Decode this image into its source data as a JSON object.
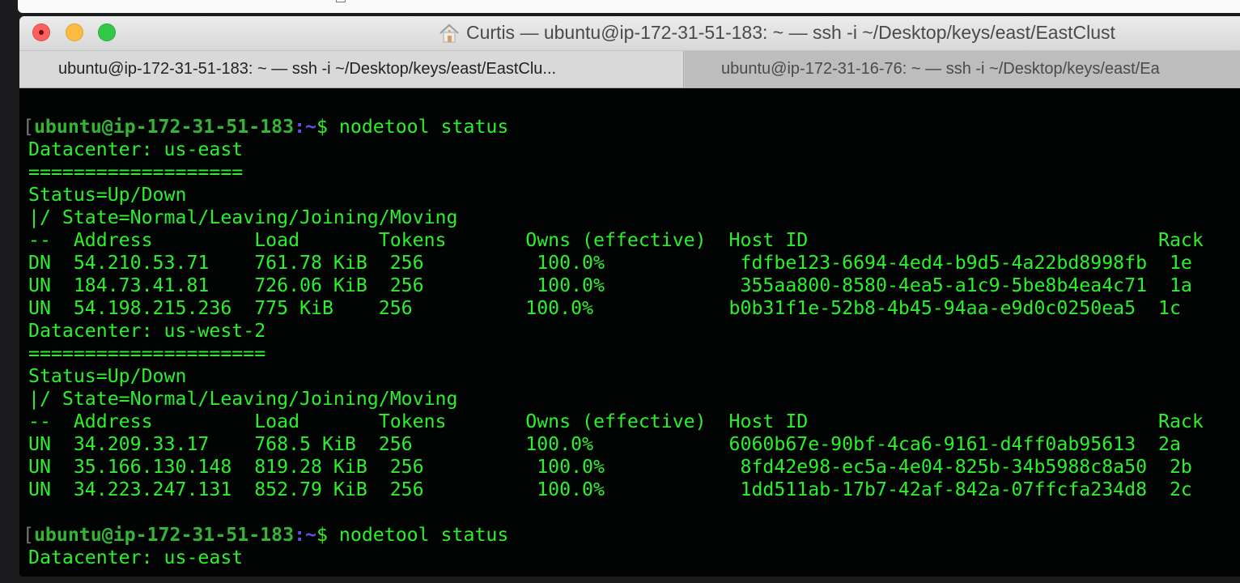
{
  "window": {
    "title": "Curtis — ubuntu@ip-172-31-51-183: ~ — ssh -i ~/Desktop/keys/east/EastClust",
    "tabs": [
      {
        "label": "ubuntu@ip-172-31-51-183: ~ — ssh -i ~/Desktop/keys/east/EastClu...",
        "active": true
      },
      {
        "label": "ubuntu@ip-172-31-16-76: ~ — ssh -i ~/Desktop/keys/east/Ea",
        "active": false
      }
    ]
  },
  "terminal": {
    "prompt": {
      "bracket": "[",
      "user_host": "ubuntu@ip-172-31-51-183",
      "colon": ":",
      "path": "~",
      "dollar": "$ ",
      "command": "nodetool status"
    },
    "block1": [
      "Datacenter: us-east",
      "===================",
      "Status=Up/Down",
      "|/ State=Normal/Leaving/Joining/Moving",
      "--  Address         Load       Tokens       Owns (effective)  Host ID                               Rack",
      "DN  54.210.53.71    761.78 KiB  256          100.0%            fdfbe123-6694-4ed4-b9d5-4a22bd8998fb  1e",
      "UN  184.73.41.81    726.06 KiB  256          100.0%            355aa800-8580-4ea5-a1c9-5be8b4ea4c71  1a",
      "UN  54.198.215.236  775 KiB    256          100.0%            b0b31f1e-52b8-4b45-94aa-e9d0c0250ea5  1c",
      "Datacenter: us-west-2",
      "=====================",
      "Status=Up/Down",
      "|/ State=Normal/Leaving/Joining/Moving",
      "--  Address         Load       Tokens       Owns (effective)  Host ID                               Rack",
      "UN  34.209.33.17    768.5 KiB  256          100.0%            6060b67e-90bf-4ca6-9161-d4ff0ab95613  2a",
      "UN  35.166.130.148  819.28 KiB  256          100.0%            8fd42e98-ec5a-4e04-825b-34b5988c8a50  2b",
      "UN  34.223.247.131  852.79 KiB  256          100.0%            1dd511ab-17b7-42af-842a-07ffcfa234d8  2c",
      ""
    ],
    "block2": [
      "Datacenter: us-east"
    ]
  }
}
